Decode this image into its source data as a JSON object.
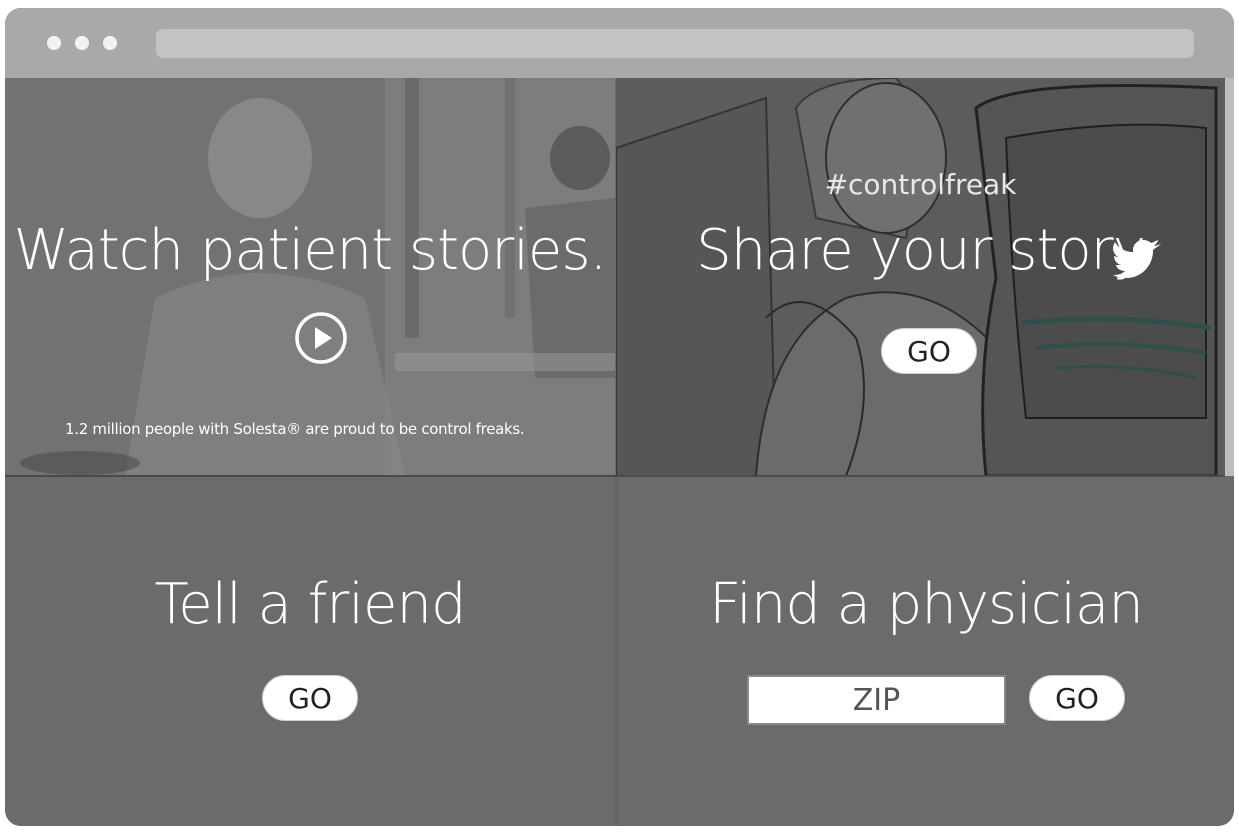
{
  "browser": {
    "controls": [
      "close",
      "minimize",
      "maximize"
    ]
  },
  "story_panel": {
    "headline": "Watch patient stories.",
    "play_icon": "play-circle-icon",
    "caption": "1.2 million people with Solesta® are proud to be control freaks."
  },
  "share_panel": {
    "hashtag": "#controlfreak",
    "headline": "Share your story",
    "social_icon": "twitter-bird-icon",
    "go_label": "GO"
  },
  "friend_panel": {
    "headline": "Tell a friend",
    "go_label": "GO"
  },
  "physician_panel": {
    "headline": "Find a physician",
    "zip_placeholder": "ZIP",
    "go_label": "GO"
  },
  "colors": {
    "chrome": "#a9a8ab",
    "panel": "#6c6b6c",
    "button": "#ffffff"
  }
}
